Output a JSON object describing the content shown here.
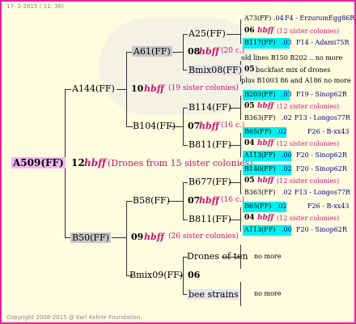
{
  "header": "17-  2-2015 ( 11: 36)",
  "footer": "Copyright 2008-2015 @ Karl Kehrle Foundation.",
  "root": {
    "name": "A509(FF)",
    "year": "12",
    "hbff": "hbff",
    "note": "(Drones from 15 sister colonies)"
  },
  "mother": {
    "name": "A144(FF)",
    "year": "10",
    "hbff": "hbff",
    "note": "(19 sister colonies)"
  },
  "father": {
    "name": "B50(FF)",
    "year": "09",
    "hbff": "hbff",
    "note": "(26 sister colonies)"
  },
  "mm": {
    "name": "A61(FF)",
    "year": "08",
    "hbff": "hbff",
    "note": "(20 c.)"
  },
  "mf": {
    "name": "B104(FF)",
    "year": "07",
    "hbff": "hbff",
    "note": "(16 c.)"
  },
  "fm": {
    "name": "B58(FF)",
    "year": "07",
    "hbff": "hbff",
    "note": "(16 c.)"
  },
  "ff": {
    "name": "Bmix09(FF)",
    "year": "06"
  },
  "mmm": {
    "name": "A25(FF)"
  },
  "mmf": {
    "name": "Bmix08(FF)",
    "year": "05",
    "note": "buckfast mix of drones"
  },
  "mfm": {
    "name": "B114(FF)"
  },
  "mff": {
    "name": "B811(FF)"
  },
  "fmm": {
    "name": "B677(FF)"
  },
  "fmf": {
    "name": "B811(FF)"
  },
  "ffm": {
    "name": "Drones of ten"
  },
  "fff": {
    "name": "bee strains"
  },
  "right": {
    "r1": {
      "name": "A73(FF)",
      "yr": ".04",
      "loc": "F4 - ErzurumEgg86R"
    },
    "r2": {
      "year": "06",
      "hbff": "hbff",
      "note": "(12 sister colonies)"
    },
    "r3": {
      "name": "B117(FF)",
      "yr": ".03",
      "loc": "F14 - Adami75R"
    },
    "r4": {
      "text": "old lines B150 B202 .. no more"
    },
    "r5": {
      "text": "plus B1003 86 and A186 no more"
    },
    "r6": {
      "name": "B203(FF)",
      "yr": ".03",
      "loc": "F19 - Sinop62R"
    },
    "r7": {
      "year": "05",
      "hbff": "hbff",
      "note": "(12 sister colonies)"
    },
    "r8": {
      "name": "B363(FF)",
      "yr": ".02",
      "loc": "F13 - Longos77R"
    },
    "r9": {
      "name": "B65(FF)",
      "yr": ".02",
      "loc": "F26 - B-xx43"
    },
    "r10": {
      "year": "04",
      "hbff": "hbff",
      "note": "(12 sister colonies)"
    },
    "r11": {
      "name": "A113(FF)",
      "yr": ".00",
      "loc": "F20 - Sinop62R"
    },
    "r12": {
      "name": "B140(FF)",
      "yr": ".02",
      "loc": "F20 - Sinop62R"
    },
    "r13": {
      "year": "05",
      "hbff": "hbff",
      "note": "(12 sister colonies)"
    },
    "r14": {
      "name": "B363(FF)",
      "yr": ".02",
      "loc": "F13 - Longos77R"
    },
    "r15": {
      "name": "B65(FF)",
      "yr": ".02",
      "loc": "F26 - B-xx43"
    },
    "r16": {
      "year": "04",
      "hbff": "hbff",
      "note": "(12 sister colonies)"
    },
    "r17": {
      "name": "A113(FF)",
      "yr": ".00",
      "loc": "F20 - Sinop62R"
    },
    "nm1": "no more",
    "nm2": "no more"
  }
}
